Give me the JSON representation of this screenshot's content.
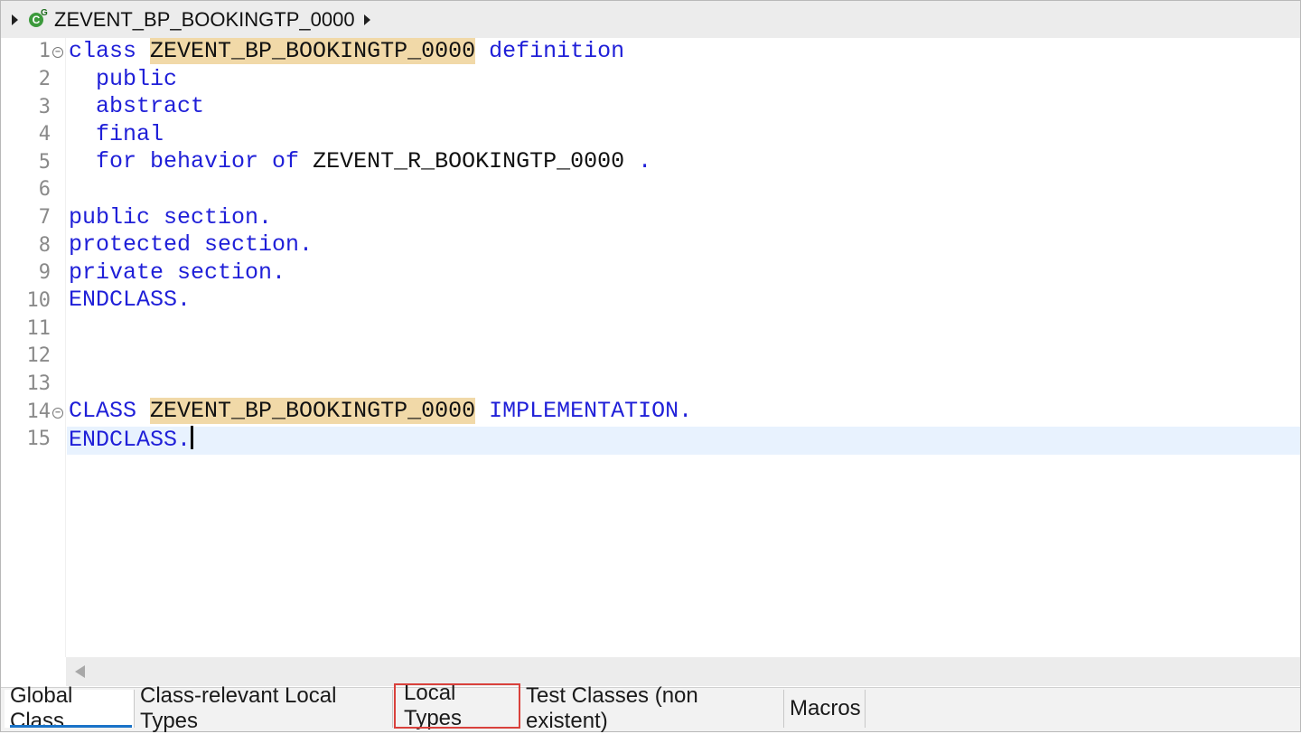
{
  "breadcrumb": {
    "icon": "global-class-icon",
    "title": "ZEVENT_BP_BOOKINGTP_0000"
  },
  "editor": {
    "lines": [
      {
        "num": "1",
        "fold": true
      },
      {
        "num": "2"
      },
      {
        "num": "3"
      },
      {
        "num": "4"
      },
      {
        "num": "5"
      },
      {
        "num": "6"
      },
      {
        "num": "7"
      },
      {
        "num": "8"
      },
      {
        "num": "9"
      },
      {
        "num": "10"
      },
      {
        "num": "11"
      },
      {
        "num": "12"
      },
      {
        "num": "13"
      },
      {
        "num": "14",
        "fold": true
      },
      {
        "num": "15",
        "current": true
      }
    ],
    "code": {
      "l1_kw1": "class",
      "l1_name": "ZEVENT_BP_BOOKINGTP_0000",
      "l1_kw2": "definition",
      "l2": "public",
      "l3": "abstract",
      "l4": "final",
      "l5_kw": "for behavior of",
      "l5_name": "ZEVENT_R_BOOKINGTP_0000",
      "l5_dot": ".",
      "l7": "public section.",
      "l8": "protected section.",
      "l9": "private section.",
      "l10": "ENDCLASS.",
      "l14_kw1": "CLASS",
      "l14_name": "ZEVENT_BP_BOOKINGTP_0000",
      "l14_kw2": "IMPLEMENTATION.",
      "l15": "ENDCLASS."
    }
  },
  "tabs": [
    {
      "label": "Global Class",
      "active": true
    },
    {
      "label": "Class-relevant Local Types"
    },
    {
      "label": "Local Types",
      "highlighted": true
    },
    {
      "label": "Test Classes (non existent)"
    },
    {
      "label": "Macros"
    }
  ],
  "colors": {
    "keyword": "#1f1fd8",
    "highlight": "#f1d9a8",
    "current_line": "#e8f2fe",
    "tab_underline": "#1a73c8",
    "callout": "#d9413c"
  }
}
